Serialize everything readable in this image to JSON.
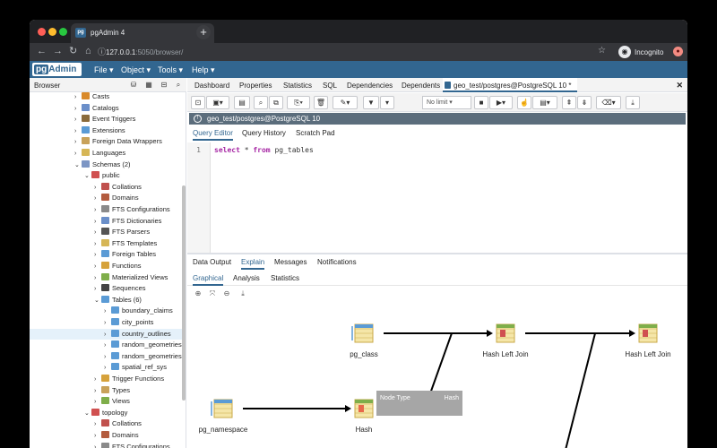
{
  "browser": {
    "tab_title": "pgAdmin 4",
    "tab_favicon": "pg",
    "url_host": "127.0.0.1",
    "url_rest": ":5050/browser/",
    "incognito_label": "Incognito"
  },
  "app": {
    "logo_pg": "pg",
    "logo_admin": "Admin",
    "menu": [
      "File",
      "Object",
      "Tools",
      "Help"
    ]
  },
  "browser_panel": {
    "title": "Browser",
    "tree": [
      {
        "label": "Casts",
        "depth": 0,
        "chev": "›",
        "color": "#d98a2b"
      },
      {
        "label": "Catalogs",
        "depth": 0,
        "chev": "›",
        "color": "#6b8fc9"
      },
      {
        "label": "Event Triggers",
        "depth": 0,
        "chev": "›",
        "color": "#8a6b3b"
      },
      {
        "label": "Extensions",
        "depth": 0,
        "chev": "›",
        "color": "#5b9bd5"
      },
      {
        "label": "Foreign Data Wrappers",
        "depth": 0,
        "chev": "›",
        "color": "#c8a25a"
      },
      {
        "label": "Languages",
        "depth": 0,
        "chev": "›",
        "color": "#d6b656"
      },
      {
        "label": "Schemas (2)",
        "depth": 0,
        "chev": "⌄",
        "color": "#7c95c4"
      },
      {
        "label": "public",
        "depth": 1,
        "chev": "⌄",
        "color": "#d05050"
      },
      {
        "label": "Collations",
        "depth": 2,
        "chev": "›",
        "color": "#c0504d"
      },
      {
        "label": "Domains",
        "depth": 2,
        "chev": "›",
        "color": "#b35c3f"
      },
      {
        "label": "FTS Configurations",
        "depth": 2,
        "chev": "›",
        "color": "#8a8a8a"
      },
      {
        "label": "FTS Dictionaries",
        "depth": 2,
        "chev": "›",
        "color": "#6b8fc9"
      },
      {
        "label": "FTS Parsers",
        "depth": 2,
        "chev": "›",
        "color": "#555555"
      },
      {
        "label": "FTS Templates",
        "depth": 2,
        "chev": "›",
        "color": "#d6b656"
      },
      {
        "label": "Foreign Tables",
        "depth": 2,
        "chev": "›",
        "color": "#5b9bd5"
      },
      {
        "label": "Functions",
        "depth": 2,
        "chev": "›",
        "color": "#d6a23b"
      },
      {
        "label": "Materialized Views",
        "depth": 2,
        "chev": "›",
        "color": "#7fae4a"
      },
      {
        "label": "Sequences",
        "depth": 2,
        "chev": "›",
        "color": "#444444"
      },
      {
        "label": "Tables (6)",
        "depth": 2,
        "chev": "⌄",
        "color": "#5b9bd5"
      },
      {
        "label": "boundary_claims",
        "depth": 3,
        "chev": "›",
        "color": "#5b9bd5"
      },
      {
        "label": "city_points",
        "depth": 3,
        "chev": "›",
        "color": "#5b9bd5"
      },
      {
        "label": "country_outlines",
        "depth": 3,
        "chev": "›",
        "color": "#5b9bd5",
        "selected": true
      },
      {
        "label": "random_geometries",
        "depth": 3,
        "chev": "›",
        "color": "#5b9bd5"
      },
      {
        "label": "random_geometries",
        "depth": 3,
        "chev": "›",
        "color": "#5b9bd5"
      },
      {
        "label": "spatial_ref_sys",
        "depth": 3,
        "chev": "›",
        "color": "#5b9bd5"
      },
      {
        "label": "Trigger Functions",
        "depth": 2,
        "chev": "›",
        "color": "#d6a23b"
      },
      {
        "label": "Types",
        "depth": 2,
        "chev": "›",
        "color": "#c8a25a"
      },
      {
        "label": "Views",
        "depth": 2,
        "chev": "›",
        "color": "#7fae4a"
      },
      {
        "label": "topology",
        "depth": 1,
        "chev": "⌄",
        "color": "#d05050"
      },
      {
        "label": "Collations",
        "depth": 2,
        "chev": "›",
        "color": "#c0504d"
      },
      {
        "label": "Domains",
        "depth": 2,
        "chev": "›",
        "color": "#b35c3f"
      },
      {
        "label": "FTS Configurations",
        "depth": 2,
        "chev": "›",
        "color": "#8a8a8a"
      }
    ]
  },
  "panel_tabs": [
    "Dashboard",
    "Properties",
    "Statistics",
    "SQL",
    "Dependencies",
    "Dependents"
  ],
  "active_tab": "geo_test/postgres@PostgreSQL 10 *",
  "toolbar": {
    "limit": "No limit"
  },
  "connection": "geo_test/postgres@PostgreSQL 10",
  "editor_tabs": [
    "Query Editor",
    "Query History",
    "Scratch Pad"
  ],
  "editor": {
    "line": "1",
    "kw1": "select",
    "mid": " * ",
    "kw2": "from",
    "rest": " pg_tables"
  },
  "output_tabs": [
    "Data Output",
    "Explain",
    "Messages",
    "Notifications"
  ],
  "explain_tabs": [
    "Graphical",
    "Analysis",
    "Statistics"
  ],
  "graph": {
    "nodes": [
      {
        "id": "pg_class",
        "label": "pg_class",
        "type": "scan"
      },
      {
        "id": "hash_left_join_1",
        "label": "Hash Left Join",
        "type": "join"
      },
      {
        "id": "hash_left_join_2",
        "label": "Hash Left Join",
        "type": "join"
      },
      {
        "id": "pg_namespace",
        "label": "pg_namespace",
        "type": "scan"
      },
      {
        "id": "hash",
        "label": "Hash",
        "type": "hash"
      }
    ]
  },
  "tooltip": {
    "key": "Node Type",
    "value": "Hash"
  }
}
